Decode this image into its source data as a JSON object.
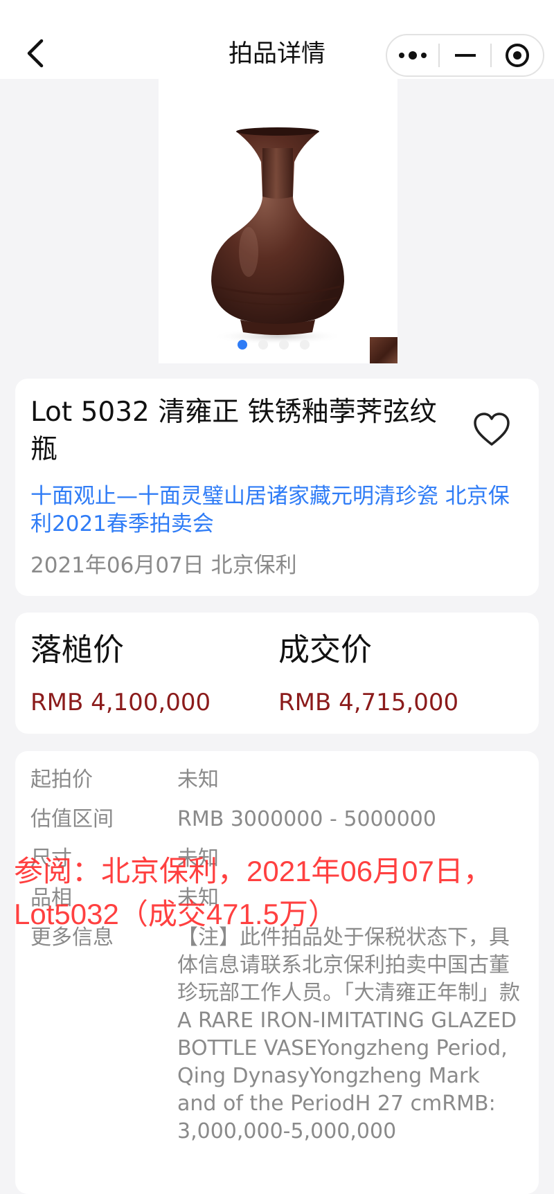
{
  "nav": {
    "title": "拍品详情",
    "back_icon": "chevron-left-icon",
    "menu_icon": "more-dots-icon",
    "minimize_icon": "minus-icon",
    "close_icon": "target-circle-icon"
  },
  "gallery": {
    "image": "rust-glazed bottle vase photo",
    "slide_count": 4,
    "active_index": 0
  },
  "lot": {
    "title": "Lot 5032 清雍正 铁锈釉荸荠弦纹瓶",
    "auction": "十面观止—十面灵璧山居诸家藏元明清珍瓷 北京保利2021春季拍卖会",
    "date_house": "2021年06月07日 北京保利",
    "favorite_icon": "heart-outline-icon"
  },
  "prices": {
    "hammer_label": "落槌价",
    "hammer_value": "RMB 4,100,000",
    "sold_label": "成交价",
    "sold_value": "RMB 4,715,000"
  },
  "details": {
    "rows": [
      {
        "label": "起拍价",
        "value": "未知"
      },
      {
        "label": "估值区间",
        "value": "RMB 3000000 - 5000000"
      },
      {
        "label": "尺寸",
        "value": "未知"
      },
      {
        "label": "品相",
        "value": "未知"
      }
    ],
    "more_label": "更多信息",
    "more_value": "【注】此件拍品处于保税状态下，具体信息请联系北京保利拍卖中国古董珍玩部工作人员。「大清雍正年制」款A RARE IRON-IMITATING GLAZED BOTTLE VASEYongzheng Period, Qing DynasyYongzheng Mark and of the PeriodH 27 cmRMB: 3,000,000-5,000,000"
  },
  "watermark": {
    "text": "参阅：北京保利，2021年06月07日，Lot5032（成交471.5万）"
  },
  "colors": {
    "accent_blue": "#2f7cf6",
    "price_red": "#8b1b1b",
    "watermark_red": "#ff3030"
  }
}
